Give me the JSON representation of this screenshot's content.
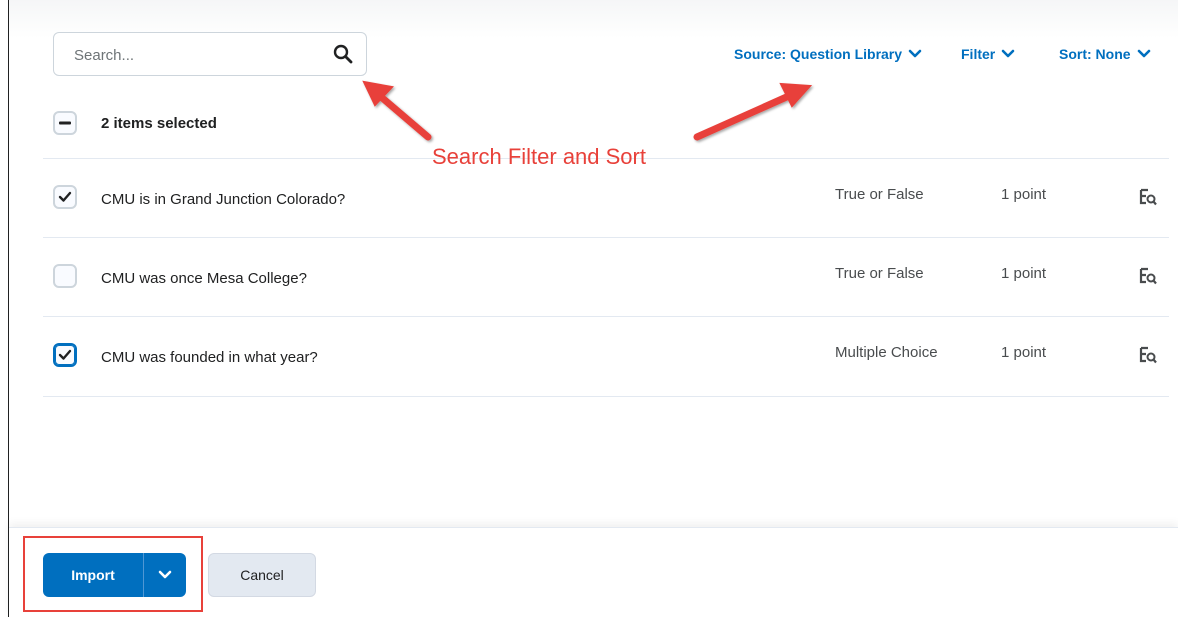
{
  "search": {
    "placeholder": "Search...",
    "value": ""
  },
  "toolbar": {
    "source_label": "Source: Question Library",
    "filter_label": "Filter",
    "sort_label": "Sort: None"
  },
  "selection": {
    "count_label": "2 items selected"
  },
  "questions": [
    {
      "text": "CMU is in Grand Junction Colorado?",
      "type": "True or False",
      "points": "1 point",
      "checked": true
    },
    {
      "text": "CMU was once Mesa College?",
      "type": "True or False",
      "points": "1 point",
      "checked": false
    },
    {
      "text": "CMU was founded in what year?",
      "type": "Multiple Choice",
      "points": "1 point",
      "checked": true
    }
  ],
  "annotation": {
    "text": "Search Filter and Sort",
    "color": "#e8413a"
  },
  "footer": {
    "import_label": "Import",
    "cancel_label": "Cancel"
  },
  "colors": {
    "accent": "#006fbf",
    "annotation": "#e8413a"
  }
}
